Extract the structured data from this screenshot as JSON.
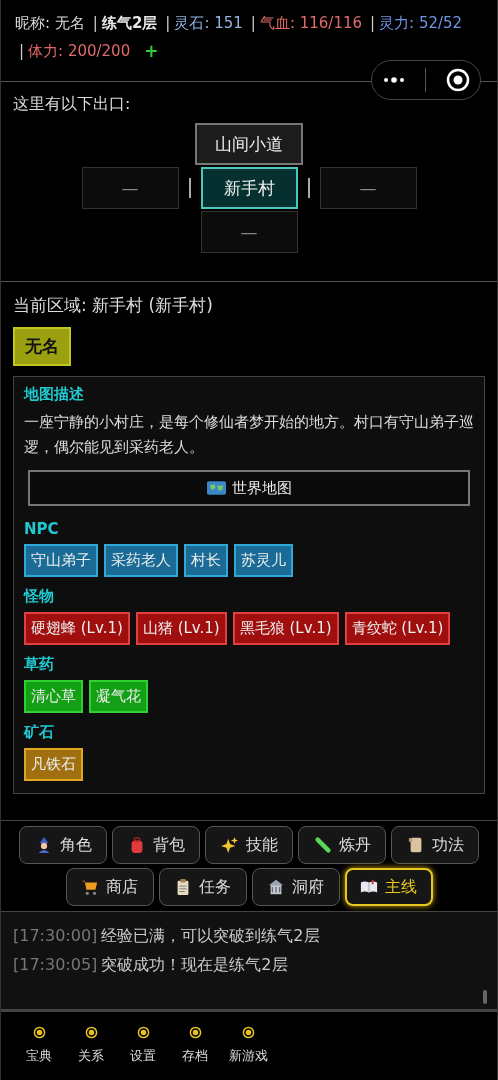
{
  "status_bar": {
    "stats": [
      {
        "kind": "plain",
        "text": "昵称: 无名"
      },
      {
        "kind": "realm",
        "sep": "|",
        "text": "练气2层"
      },
      {
        "kind": "stone",
        "sep": "|",
        "text": "灵石: 151"
      },
      {
        "kind": "hp",
        "sep": "|",
        "text": "气血: 116/116"
      },
      {
        "kind": "mp",
        "sep": "|",
        "text": "灵力: 52/52"
      },
      {
        "kind": "hp",
        "sep": "|",
        "text": "体力: 200/200"
      }
    ],
    "add": "+"
  },
  "exits": {
    "heading": "这里有以下出口:",
    "north": {
      "label": "山间小道",
      "selected": false
    },
    "west": {
      "label": "—",
      "selected": false
    },
    "center": {
      "label": "新手村",
      "selected": true
    },
    "east": {
      "label": "—",
      "selected": false
    },
    "south": {
      "label": "—",
      "selected": false
    }
  },
  "region": {
    "title": "当前区域: 新手村 (新手村)",
    "player": "无名",
    "description": {
      "title": "地图描述",
      "text": "一座宁静的小村庄，是每个修仙者梦开始的地方。村口有守山弟子巡逻，偶尔能见到采药老人。",
      "map_button": "世界地图"
    },
    "sections": [
      {
        "kind": "npc",
        "title": "NPC",
        "items": [
          "守山弟子",
          "采药老人",
          "村长",
          "苏灵儿"
        ]
      },
      {
        "kind": "monster",
        "title": "怪物",
        "items": [
          "硬翅蜂 (Lv.1)",
          "山猪 (Lv.1)",
          "黑毛狼 (Lv.1)",
          "青纹蛇 (Lv.1)"
        ]
      },
      {
        "kind": "herb",
        "title": "草药",
        "items": [
          "清心草",
          "凝气花"
        ]
      },
      {
        "kind": "ore",
        "title": "矿石",
        "items": [
          "凡铁石"
        ]
      }
    ]
  },
  "menu": [
    {
      "label": "角色",
      "selected": false
    },
    {
      "label": "背包",
      "selected": false
    },
    {
      "label": "技能",
      "selected": false
    },
    {
      "label": "炼丹",
      "selected": false
    },
    {
      "label": "功法",
      "selected": false
    },
    {
      "label": "商店",
      "selected": false
    },
    {
      "label": "任务",
      "selected": false
    },
    {
      "label": "洞府",
      "selected": false
    },
    {
      "label": "主线",
      "selected": true
    }
  ],
  "log": [
    {
      "time": "[17:30:00]",
      "text": "经验已满，可以突破到练气2层"
    },
    {
      "time": "[17:30:05]",
      "text": "突破成功！现在是练气2层"
    }
  ],
  "bottom_nav": [
    "宝典",
    "关系",
    "设置",
    "存档",
    "新游戏"
  ]
}
